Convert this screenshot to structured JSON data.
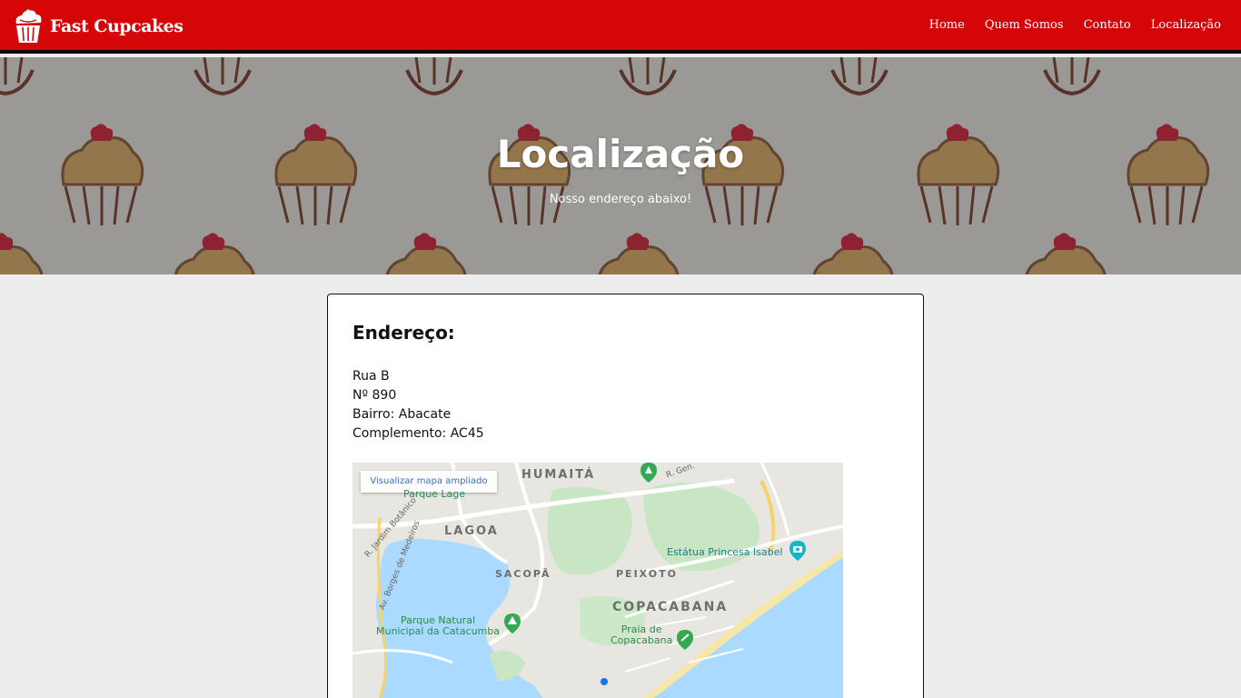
{
  "navbar": {
    "brand": "Fast Cupcakes",
    "links": [
      "Home",
      "Quem Somos",
      "Contato",
      "Localização"
    ]
  },
  "hero": {
    "title": "Localização",
    "subtitle": "Nosso endereço abaixo!"
  },
  "address": {
    "heading": "Endereço:",
    "lines": [
      "Rua B",
      "Nº 890",
      "Bairro: Abacate",
      "Complemento: AC45"
    ]
  },
  "map": {
    "button": "Visualizar mapa ampliado",
    "districts": [
      "HUMAITÁ",
      "LAGOA",
      "SACOPÃ",
      "PEIXOTO",
      "COPACABANA"
    ],
    "places": [
      "Parque Lage",
      "Estátua Princesa Isabel",
      "Parque Natural\nMunicipal da Catacumba",
      "Praia de\nCopacabana"
    ],
    "streets": [
      "R. Jardim Botânico",
      "Av. Borges de Medeiros",
      "R. Gen."
    ]
  },
  "colors": {
    "brand_red": "#d40608",
    "nav_border": "#0a0a0a",
    "page_bg": "#ededed",
    "map_water": "#aadaff",
    "map_park": "#c8e6c4",
    "map_link": "#2f6fd6"
  }
}
